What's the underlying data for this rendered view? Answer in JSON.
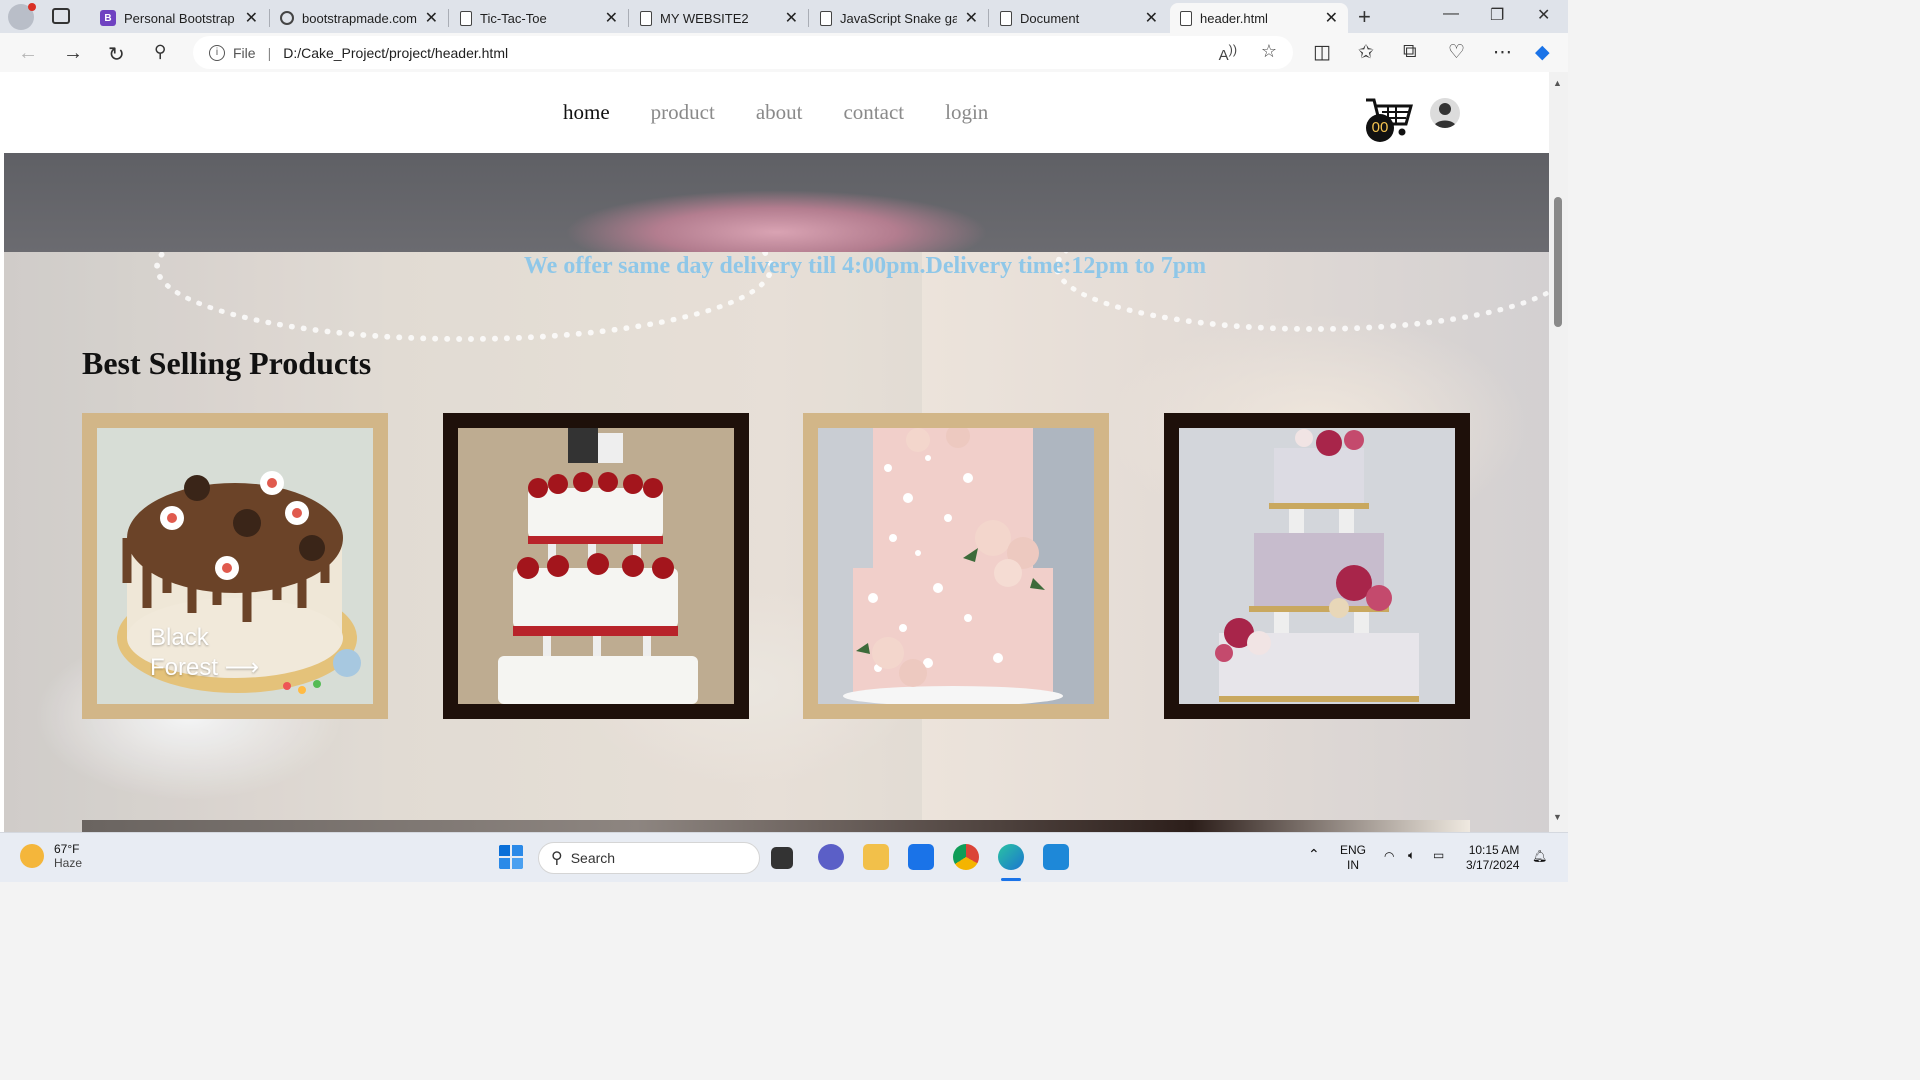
{
  "browser": {
    "tabs": [
      {
        "title": "Personal Bootstrap Te",
        "icon": "bootstrap-icon"
      },
      {
        "title": "bootstrapmade.com",
        "icon": "gear-icon"
      },
      {
        "title": "Tic-Tac-Toe",
        "icon": "page-icon"
      },
      {
        "title": "MY WEBSITE2",
        "icon": "page-icon"
      },
      {
        "title": "JavaScript Snake gam",
        "icon": "page-icon"
      },
      {
        "title": "Document",
        "icon": "page-icon"
      },
      {
        "title": "header.html",
        "icon": "page-icon",
        "active": true
      }
    ],
    "address": {
      "scheme_label": "File",
      "url": "D:/Cake_Project/project/header.html"
    }
  },
  "site": {
    "nav": [
      {
        "label": "home",
        "active": true
      },
      {
        "label": "product"
      },
      {
        "label": "about"
      },
      {
        "label": "contact"
      },
      {
        "label": "login"
      }
    ],
    "cart_count": "00",
    "delivery_text": "We offer same day delivery till 4:00pm.Delivery time:12pm to 7pm",
    "section_title": "Best Selling Products",
    "products": [
      {
        "caption_line1": "Black",
        "caption_line2": "Forest ⟶",
        "frame": "gold",
        "image": "chocolate-oreo-cake"
      },
      {
        "caption_line1": "",
        "caption_line2": "",
        "frame": "dark",
        "image": "red-rose-wedding-cake"
      },
      {
        "caption_line1": "",
        "caption_line2": "",
        "frame": "gold",
        "image": "pink-pearl-floral-cake"
      },
      {
        "caption_line1": "",
        "caption_line2": "",
        "frame": "dark",
        "image": "lace-floral-tier-cake"
      }
    ],
    "colors": {
      "gold_frame": "#d2b688",
      "dark_frame": "#1e100a",
      "delivery_text": "#8fc7e8"
    }
  },
  "taskbar": {
    "weather": {
      "temp": "67°F",
      "condition": "Haze"
    },
    "search_placeholder": "Search",
    "language": {
      "line1": "ENG",
      "line2": "IN"
    },
    "clock": {
      "time": "10:15 AM",
      "date": "3/17/2024"
    }
  }
}
